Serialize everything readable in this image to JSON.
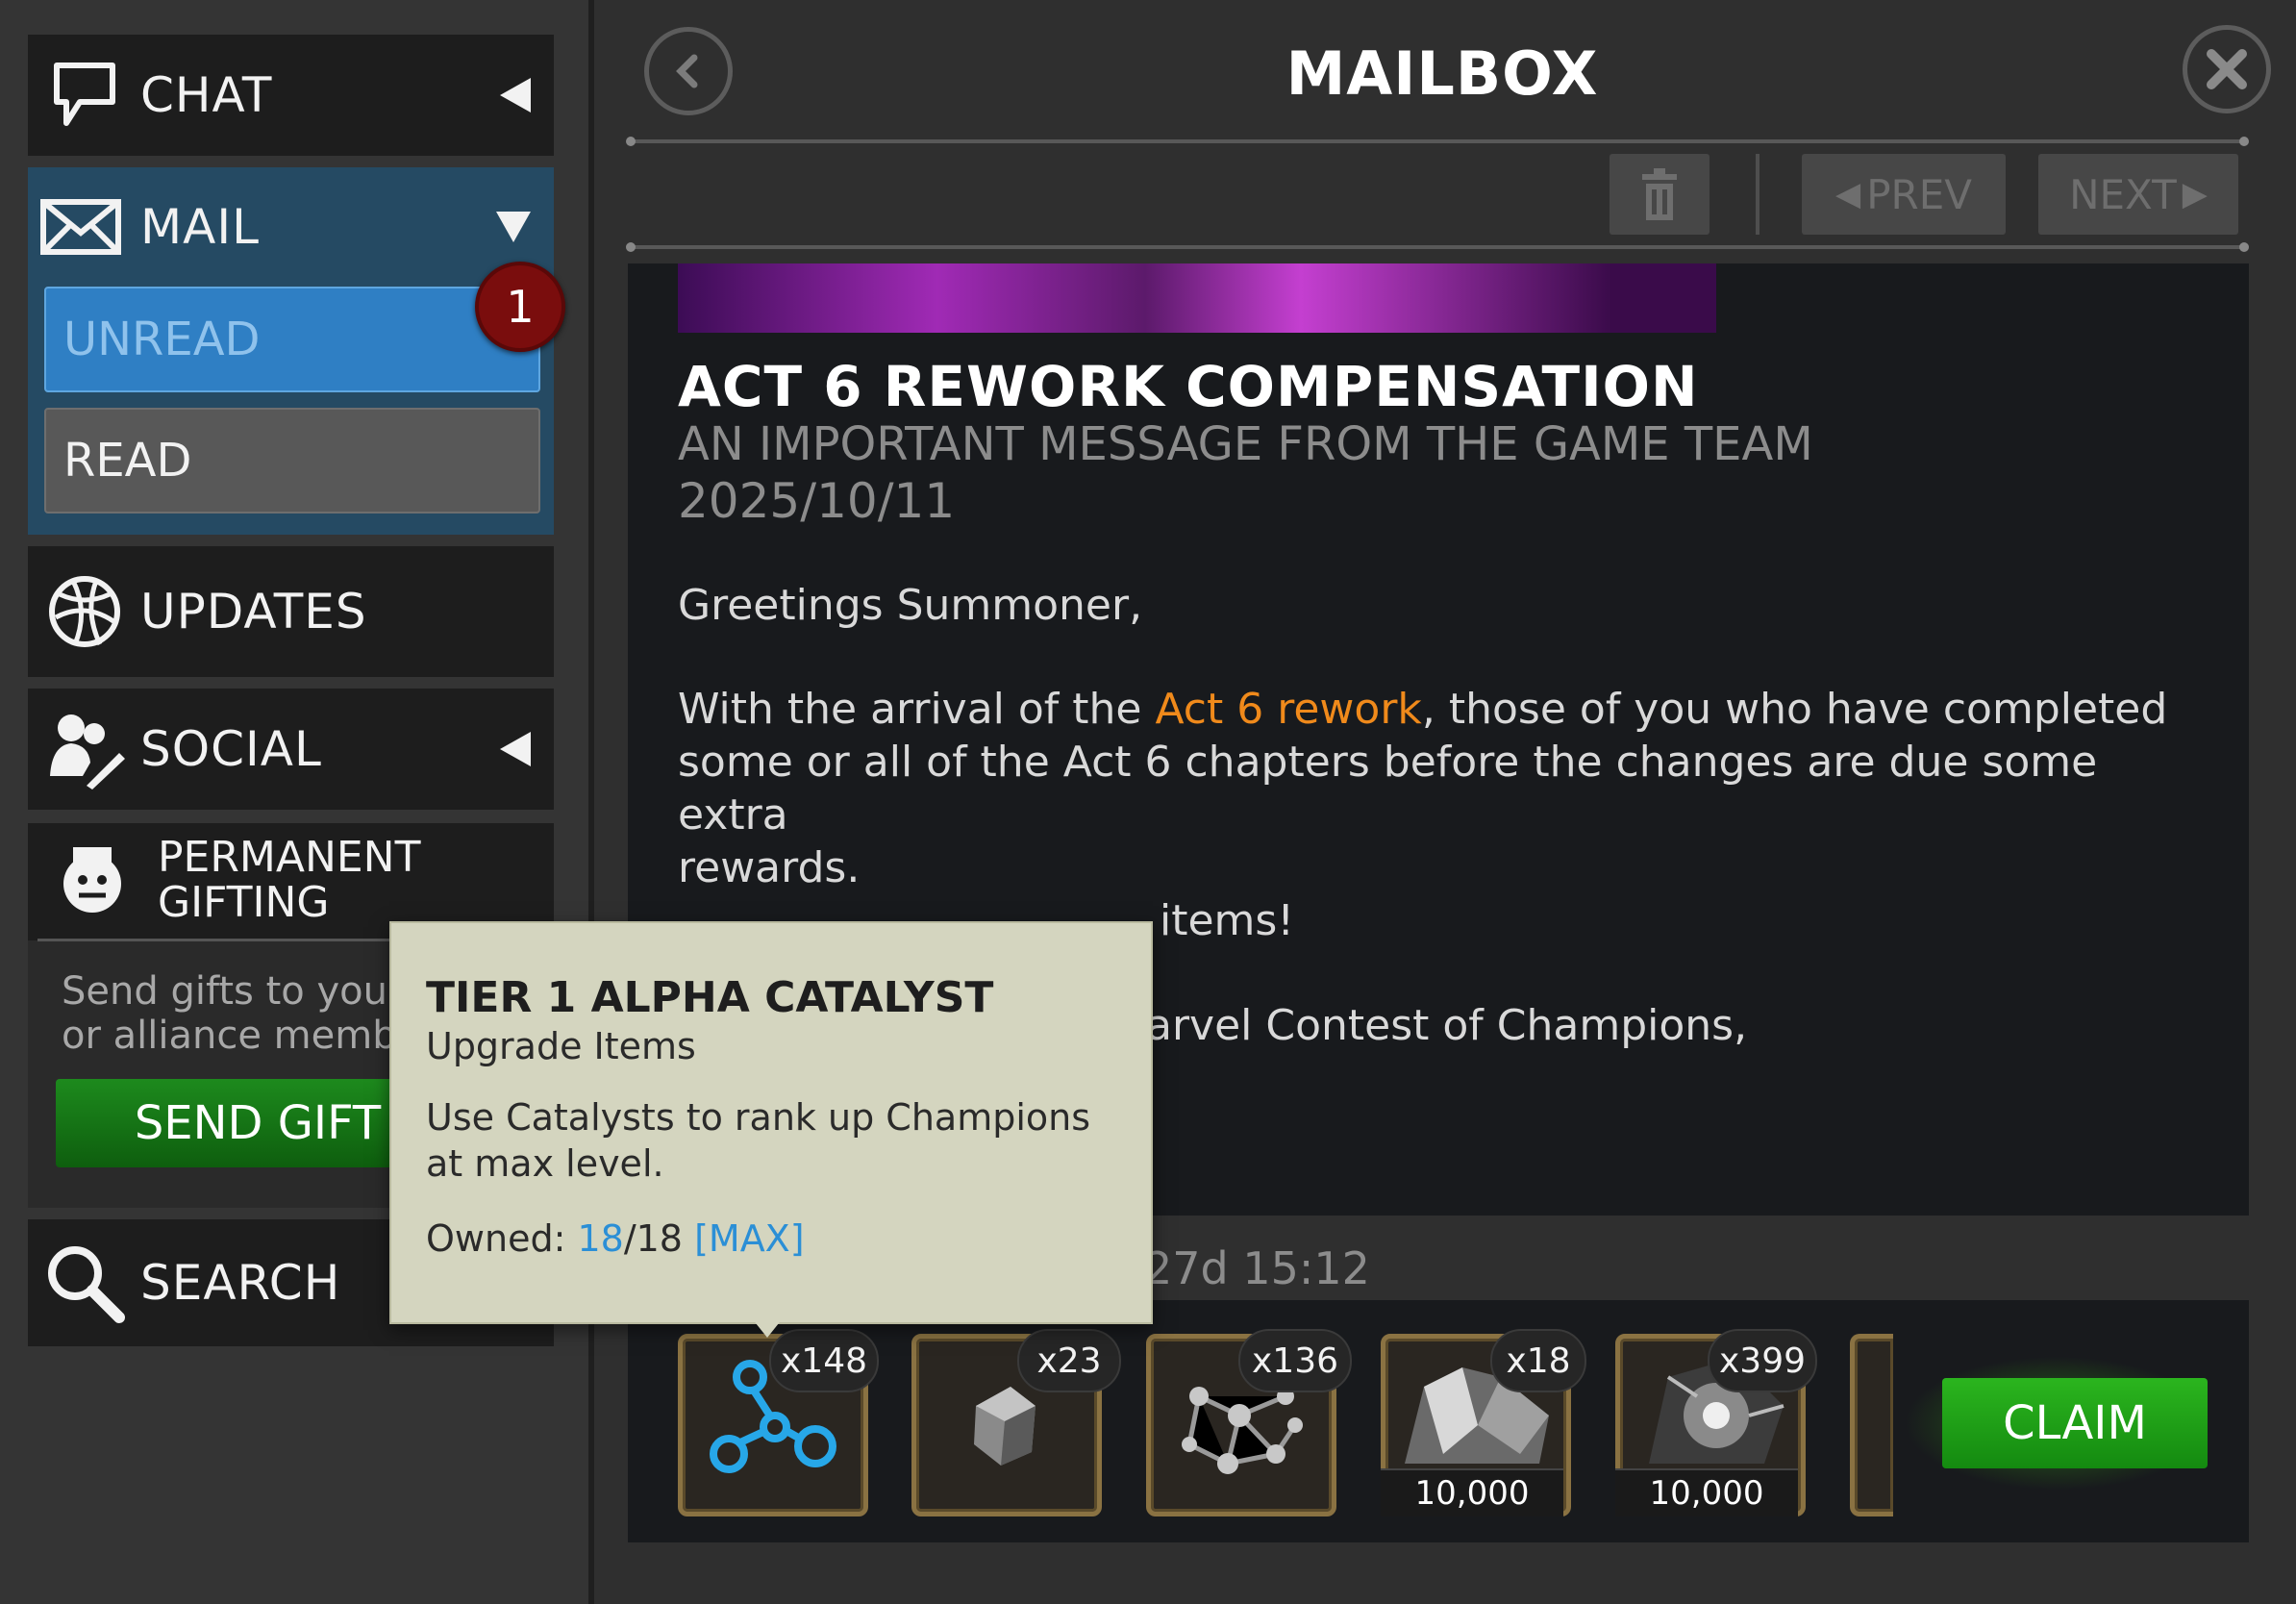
{
  "sidebar": {
    "chat_label": "CHAT",
    "mail_label": "MAIL",
    "unread_label": "UNREAD",
    "unread_count": "1",
    "read_label": "READ",
    "updates_label": "UPDATES",
    "social_label": "SOCIAL",
    "gifting_line1": "PERMANENT",
    "gifting_line2": "GIFTING",
    "gift_desc_line1": "Send gifts to your",
    "gift_desc_line2": "or alliance membe",
    "send_gift_label": "SEND GIFT",
    "search_label": "SEARCH"
  },
  "header": {
    "title": "MAILBOX",
    "prev_label": "PREV",
    "next_label": "NEXT"
  },
  "message": {
    "title": "ACT 6 REWORK COMPENSATION",
    "subtitle": "AN IMPORTANT MESSAGE FROM THE GAME TEAM",
    "date": "2025/10/11",
    "greeting": "Greetings Summoner,",
    "p1_before": "With the arrival of the ",
    "p1_link": "Act 6 rework",
    "p1_after_line1": ", those of you who have completed",
    "p1_line2": "some or all of the Act 6 chapters before the changes are due some extra",
    "p1_line3": "rewards.",
    "p2_partial": "items!",
    "p3_partial": "arvel Contest of Champions,",
    "expires": "27d 15:12"
  },
  "rewards": [
    {
      "icon": "alpha-catalyst-icon",
      "qty": "x148",
      "label": ""
    },
    {
      "icon": "ore-icon",
      "qty": "x23",
      "label": ""
    },
    {
      "icon": "molecule-catalyst-icon",
      "qty": "x136",
      "label": ""
    },
    {
      "icon": "crystal-icon",
      "qty": "x18",
      "label": "10,000"
    },
    {
      "icon": "crystal-nebula-icon",
      "qty": "x399",
      "label": "10,000"
    }
  ],
  "claim_label": "CLAIM",
  "tooltip": {
    "title": "TIER 1 ALPHA CATALYST",
    "category": "Upgrade Items",
    "description": "Use Catalysts to rank up Champions at max level.",
    "owned_label": "Owned: ",
    "owned_current": "18",
    "owned_sep": "/18 ",
    "owned_max": "[MAX]"
  },
  "colors": {
    "accent_orange": "#f08a1b",
    "unread_blue": "#2f7fc4",
    "claim_green": "#2bb51e",
    "badge_red": "#7a0d0d",
    "tooltip_bg": "#d4d5bf"
  }
}
